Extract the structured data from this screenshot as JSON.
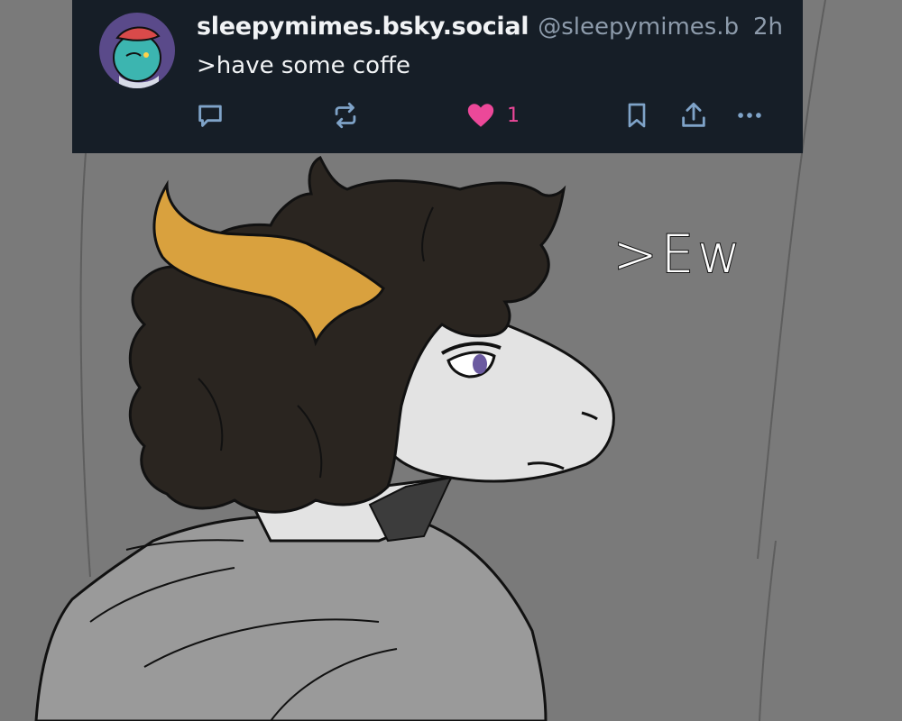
{
  "post": {
    "display_name": "sleepymimes.bsky.social",
    "handle": "@sleepymimes.b...",
    "timestamp": "2h",
    "text": ">have some coffe",
    "like_count": "1"
  },
  "artwork": {
    "speech_text": ">Ew"
  },
  "colors": {
    "card_bg": "#161e27",
    "text_primary": "#f1f3f5",
    "text_secondary": "#8d9bab",
    "action_icon": "#7fa3c8",
    "like_pink": "#ec4899",
    "background_gray": "#7a7a7a",
    "hair_dark": "#2a2520",
    "hair_orange": "#d9a13e",
    "face_white": "#e3e3e3",
    "hoodie_gray": "#9a9a9a"
  },
  "icons": {
    "reply": "speech-bubble-icon",
    "repost": "repost-arrows-icon",
    "like": "heart-icon",
    "bookmark": "bookmark-icon",
    "share": "share-icon",
    "more": "ellipsis-icon"
  }
}
